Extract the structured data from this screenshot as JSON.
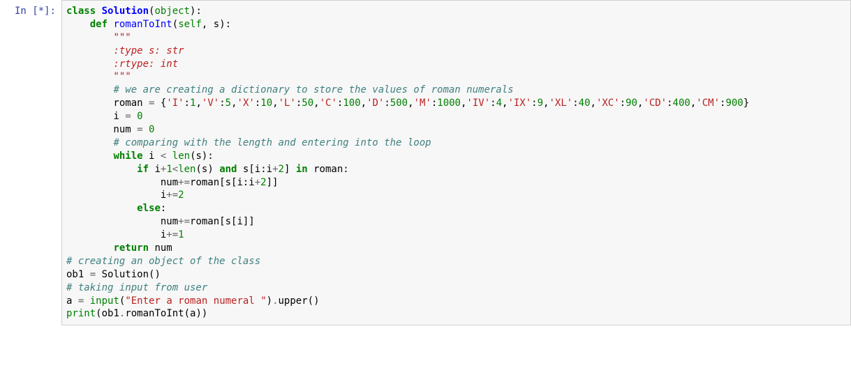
{
  "cell": {
    "prompt": "In [*]:",
    "tokens": [
      {
        "c": "k",
        "t": "class"
      },
      {
        "c": "p",
        "t": " "
      },
      {
        "c": "nc",
        "t": "Solution"
      },
      {
        "c": "p",
        "t": "("
      },
      {
        "c": "bi",
        "t": "object"
      },
      {
        "c": "p",
        "t": "):"
      },
      {
        "nl": true
      },
      {
        "c": "p",
        "t": "    "
      },
      {
        "c": "k",
        "t": "def"
      },
      {
        "c": "p",
        "t": " "
      },
      {
        "c": "nf",
        "t": "romanToInt"
      },
      {
        "c": "p",
        "t": "("
      },
      {
        "c": "bi",
        "t": "self"
      },
      {
        "c": "p",
        "t": ", s):"
      },
      {
        "nl": true
      },
      {
        "c": "p",
        "t": "        "
      },
      {
        "c": "sd",
        "t": "\"\"\""
      },
      {
        "nl": true
      },
      {
        "c": "sd",
        "t": "        :type s: str"
      },
      {
        "nl": true
      },
      {
        "c": "sd",
        "t": "        :rtype: int"
      },
      {
        "nl": true
      },
      {
        "c": "sd",
        "t": "        \"\"\""
      },
      {
        "nl": true
      },
      {
        "c": "p",
        "t": "        "
      },
      {
        "c": "c",
        "t": "# we are creating a dictionary to store the values of roman numerals"
      },
      {
        "nl": true
      },
      {
        "c": "p",
        "t": "        roman "
      },
      {
        "c": "op",
        "t": "="
      },
      {
        "c": "p",
        "t": " {"
      },
      {
        "c": "s",
        "t": "'I'"
      },
      {
        "c": "p",
        "t": ":"
      },
      {
        "c": "n",
        "t": "1"
      },
      {
        "c": "p",
        "t": ","
      },
      {
        "c": "s",
        "t": "'V'"
      },
      {
        "c": "p",
        "t": ":"
      },
      {
        "c": "n",
        "t": "5"
      },
      {
        "c": "p",
        "t": ","
      },
      {
        "c": "s",
        "t": "'X'"
      },
      {
        "c": "p",
        "t": ":"
      },
      {
        "c": "n",
        "t": "10"
      },
      {
        "c": "p",
        "t": ","
      },
      {
        "c": "s",
        "t": "'L'"
      },
      {
        "c": "p",
        "t": ":"
      },
      {
        "c": "n",
        "t": "50"
      },
      {
        "c": "p",
        "t": ","
      },
      {
        "c": "s",
        "t": "'C'"
      },
      {
        "c": "p",
        "t": ":"
      },
      {
        "c": "n",
        "t": "100"
      },
      {
        "c": "p",
        "t": ","
      },
      {
        "c": "s",
        "t": "'D'"
      },
      {
        "c": "p",
        "t": ":"
      },
      {
        "c": "n",
        "t": "500"
      },
      {
        "c": "p",
        "t": ","
      },
      {
        "c": "s",
        "t": "'M'"
      },
      {
        "c": "p",
        "t": ":"
      },
      {
        "c": "n",
        "t": "1000"
      },
      {
        "c": "p",
        "t": ","
      },
      {
        "c": "s",
        "t": "'IV'"
      },
      {
        "c": "p",
        "t": ":"
      },
      {
        "c": "n",
        "t": "4"
      },
      {
        "c": "p",
        "t": ","
      },
      {
        "c": "s",
        "t": "'IX'"
      },
      {
        "c": "p",
        "t": ":"
      },
      {
        "c": "n",
        "t": "9"
      },
      {
        "c": "p",
        "t": ","
      },
      {
        "c": "s",
        "t": "'XL'"
      },
      {
        "c": "p",
        "t": ":"
      },
      {
        "c": "n",
        "t": "40"
      },
      {
        "c": "p",
        "t": ","
      },
      {
        "c": "s",
        "t": "'XC'"
      },
      {
        "c": "p",
        "t": ":"
      },
      {
        "c": "n",
        "t": "90"
      },
      {
        "c": "p",
        "t": ","
      },
      {
        "c": "s",
        "t": "'CD'"
      },
      {
        "c": "p",
        "t": ":"
      },
      {
        "c": "n",
        "t": "400"
      },
      {
        "c": "p",
        "t": ","
      },
      {
        "c": "s",
        "t": "'CM'"
      },
      {
        "c": "p",
        "t": ":"
      },
      {
        "c": "n",
        "t": "900"
      },
      {
        "c": "p",
        "t": "}"
      },
      {
        "nl": true
      },
      {
        "c": "p",
        "t": "        i "
      },
      {
        "c": "op",
        "t": "="
      },
      {
        "c": "p",
        "t": " "
      },
      {
        "c": "n",
        "t": "0"
      },
      {
        "nl": true
      },
      {
        "c": "p",
        "t": "        num "
      },
      {
        "c": "op",
        "t": "="
      },
      {
        "c": "p",
        "t": " "
      },
      {
        "c": "n",
        "t": "0"
      },
      {
        "nl": true
      },
      {
        "c": "p",
        "t": "        "
      },
      {
        "c": "c",
        "t": "# comparing with the length and entering into the loop"
      },
      {
        "nl": true
      },
      {
        "c": "p",
        "t": "        "
      },
      {
        "c": "k",
        "t": "while"
      },
      {
        "c": "p",
        "t": " i "
      },
      {
        "c": "op",
        "t": "<"
      },
      {
        "c": "p",
        "t": " "
      },
      {
        "c": "bi",
        "t": "len"
      },
      {
        "c": "p",
        "t": "(s):"
      },
      {
        "nl": true
      },
      {
        "c": "p",
        "t": "            "
      },
      {
        "c": "k",
        "t": "if"
      },
      {
        "c": "p",
        "t": " i"
      },
      {
        "c": "op",
        "t": "+"
      },
      {
        "c": "n",
        "t": "1"
      },
      {
        "c": "op",
        "t": "<"
      },
      {
        "c": "bi",
        "t": "len"
      },
      {
        "c": "p",
        "t": "(s) "
      },
      {
        "c": "k",
        "t": "and"
      },
      {
        "c": "p",
        "t": " s[i:i"
      },
      {
        "c": "op",
        "t": "+"
      },
      {
        "c": "n",
        "t": "2"
      },
      {
        "c": "p",
        "t": "] "
      },
      {
        "c": "k",
        "t": "in"
      },
      {
        "c": "p",
        "t": " roman:"
      },
      {
        "nl": true
      },
      {
        "c": "p",
        "t": "                num"
      },
      {
        "c": "op",
        "t": "+="
      },
      {
        "c": "p",
        "t": "roman[s[i:i"
      },
      {
        "c": "op",
        "t": "+"
      },
      {
        "c": "n",
        "t": "2"
      },
      {
        "c": "p",
        "t": "]]"
      },
      {
        "nl": true
      },
      {
        "c": "p",
        "t": "                i"
      },
      {
        "c": "op",
        "t": "+="
      },
      {
        "c": "n",
        "t": "2"
      },
      {
        "nl": true
      },
      {
        "c": "p",
        "t": "            "
      },
      {
        "c": "k",
        "t": "else"
      },
      {
        "c": "p",
        "t": ":"
      },
      {
        "nl": true
      },
      {
        "c": "p",
        "t": "                num"
      },
      {
        "c": "op",
        "t": "+="
      },
      {
        "c": "p",
        "t": "roman[s[i]]"
      },
      {
        "nl": true
      },
      {
        "c": "p",
        "t": "                i"
      },
      {
        "c": "op",
        "t": "+="
      },
      {
        "c": "n",
        "t": "1"
      },
      {
        "nl": true
      },
      {
        "c": "p",
        "t": "        "
      },
      {
        "c": "k",
        "t": "return"
      },
      {
        "c": "p",
        "t": " num"
      },
      {
        "nl": true
      },
      {
        "c": "c",
        "t": "# creating an object of the class"
      },
      {
        "nl": true
      },
      {
        "c": "p",
        "t": "ob1 "
      },
      {
        "c": "op",
        "t": "="
      },
      {
        "c": "p",
        "t": " Solution()"
      },
      {
        "nl": true
      },
      {
        "c": "c",
        "t": "# taking input from user"
      },
      {
        "nl": true
      },
      {
        "c": "p",
        "t": "a "
      },
      {
        "c": "op",
        "t": "="
      },
      {
        "c": "p",
        "t": " "
      },
      {
        "c": "bi",
        "t": "input"
      },
      {
        "c": "p",
        "t": "("
      },
      {
        "c": "s",
        "t": "\"Enter a roman numeral \""
      },
      {
        "c": "p",
        "t": ")"
      },
      {
        "c": "op",
        "t": "."
      },
      {
        "c": "p",
        "t": "upper()"
      },
      {
        "nl": true
      },
      {
        "c": "bi",
        "t": "print"
      },
      {
        "c": "p",
        "t": "(ob1"
      },
      {
        "c": "op",
        "t": "."
      },
      {
        "c": "p",
        "t": "romanToInt(a))"
      }
    ]
  }
}
